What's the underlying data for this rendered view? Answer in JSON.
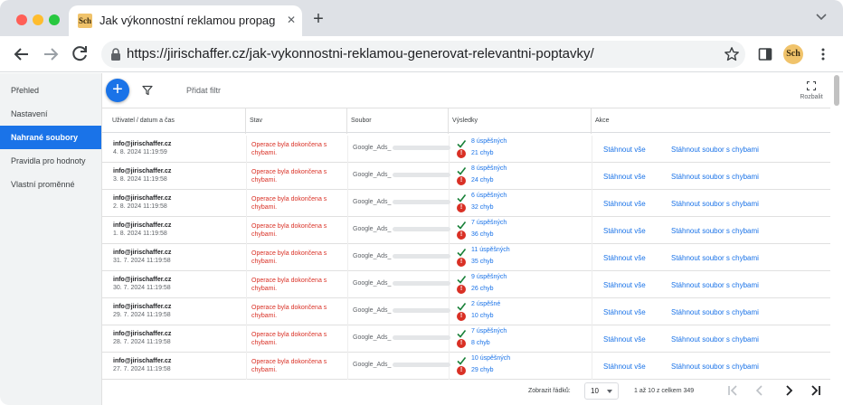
{
  "browser": {
    "tab_favicon": "Sch",
    "tab_title": "Jak výkonnostní reklamou propag",
    "url": "https://jirischaffer.cz/jak-vykonnostni-reklamou-generovat-relevantni-poptavky/",
    "profile_initials": "Sch"
  },
  "sidebar": {
    "items": [
      {
        "label": "Přehled",
        "active": false
      },
      {
        "label": "Nastavení",
        "active": false
      },
      {
        "label": "Nahrané soubory",
        "active": true
      },
      {
        "label": "Pravidla pro hodnoty",
        "active": false
      },
      {
        "label": "Vlastní proměnné",
        "active": false
      }
    ]
  },
  "toolbar": {
    "add_button": "+",
    "add_filter": "Přidat filtr",
    "expand_label": "Rozbalit"
  },
  "table": {
    "headers": [
      "Uživatel / datum a čas",
      "Stav",
      "Soubor",
      "Výsledky",
      "Akce"
    ],
    "rows": [
      {
        "user": "info@jirischaffer.cz",
        "date": "4. 8. 2024 11:19:59",
        "status": "Operace byla dokončena s chybami.",
        "file": "Google_Ads_",
        "ok": "8 úspěšných",
        "err": "21 chyb"
      },
      {
        "user": "info@jirischaffer.cz",
        "date": "3. 8. 2024 11:19:58",
        "status": "Operace byla dokončena s chybami.",
        "file": "Google_Ads_",
        "ok": "8 úspěšných",
        "err": "24 chyb"
      },
      {
        "user": "info@jirischaffer.cz",
        "date": "2. 8. 2024 11:19:58",
        "status": "Operace byla dokončena s chybami.",
        "file": "Google_Ads_",
        "ok": "6 úspěšných",
        "err": "32 chyb"
      },
      {
        "user": "info@jirischaffer.cz",
        "date": "1. 8. 2024 11:19:58",
        "status": "Operace byla dokončena s chybami.",
        "file": "Google_Ads_",
        "ok": "7 úspěšných",
        "err": "36 chyb"
      },
      {
        "user": "info@jirischaffer.cz",
        "date": "31. 7. 2024 11:19:58",
        "status": "Operace byla dokončena s chybami.",
        "file": "Google_Ads_",
        "ok": "11 úspěšných",
        "err": "35 chyb"
      },
      {
        "user": "info@jirischaffer.cz",
        "date": "30. 7. 2024 11:19:58",
        "status": "Operace byla dokončena s chybami.",
        "file": "Google_Ads_",
        "ok": "9 úspěšných",
        "err": "26 chyb"
      },
      {
        "user": "info@jirischaffer.cz",
        "date": "29. 7. 2024 11:19:58",
        "status": "Operace byla dokončena s chybami.",
        "file": "Google_Ads_",
        "ok": "2 úspěšné",
        "err": "10 chyb"
      },
      {
        "user": "info@jirischaffer.cz",
        "date": "28. 7. 2024 11:19:58",
        "status": "Operace byla dokončena s chybami.",
        "file": "Google_Ads_",
        "ok": "7 úspěšných",
        "err": "8 chyb"
      },
      {
        "user": "info@jirischaffer.cz",
        "date": "27. 7. 2024 11:19:58",
        "status": "Operace byla dokončena s chybami.",
        "file": "Google_Ads_",
        "ok": "10 úspěšných",
        "err": "29 chyb"
      }
    ],
    "actions": {
      "download_all": "Stáhnout vše",
      "download_errors": "Stáhnout soubor s chybami"
    }
  },
  "pagination": {
    "rows_label": "Zobrazit řádků:",
    "rows_value": "10",
    "range": "1 až 10 z celkem 349"
  },
  "colors": {
    "accent": "#1a73e8",
    "error": "#d93025",
    "success": "#188038"
  }
}
